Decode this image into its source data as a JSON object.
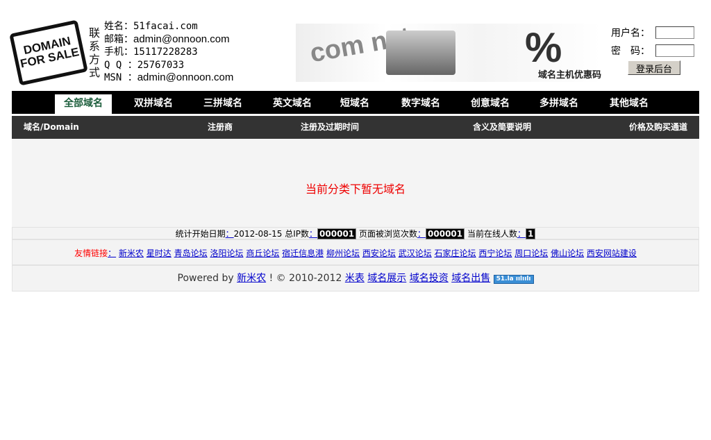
{
  "logo_text": "DOMAIN FOR SALE",
  "contact": {
    "heading": "联系方式",
    "rows": [
      {
        "label": "姓名：",
        "value": "51facai.com"
      },
      {
        "label": "邮箱：",
        "value": "admin@onnoon.com"
      },
      {
        "label": "手机：",
        "value": "15117228283"
      },
      {
        "label": "Q Q ：",
        "value": "25767033"
      },
      {
        "label": "MSN ：",
        "value": "admin@onnoon.com"
      }
    ]
  },
  "banner": {
    "caption": "域名主机优惠码",
    "art": "com net",
    "pct": "%"
  },
  "login": {
    "username_label": "用户名：",
    "password_label": "密　码：",
    "submit": "登录后台"
  },
  "nav": [
    "全部域名",
    "双拼域名",
    "三拼域名",
    "英文域名",
    "短域名",
    "数字域名",
    "创意域名",
    "多拼域名",
    "其他域名"
  ],
  "columns": [
    "域名/Domain",
    "注册商",
    "注册及过期时间",
    "含义及简要说明",
    "价格及购买通道"
  ],
  "empty_message": "当前分类下暂无域名",
  "stats": {
    "start_label": "统计开始日期",
    "start": "2012-08-15",
    "ip_label": "总IP数",
    "ip": "000001",
    "views_label": "页面被浏览次数",
    "views": "000001",
    "online_label": "当前在线人数",
    "online": "1",
    "sep": "："
  },
  "links": {
    "label": "友情链接",
    "sep": "：",
    "items": [
      "新米农",
      "星时达",
      "青岛论坛",
      "洛阳论坛",
      "商丘论坛",
      "宿迁信息港",
      "柳州论坛",
      "西安论坛",
      "武汉论坛",
      "石家庄论坛",
      "西宁论坛",
      "周口论坛",
      "佛山论坛",
      "西安网站建设"
    ]
  },
  "footer": {
    "powered": "Powered by",
    "brand": "新米农",
    "copy": "! © 2010-2012",
    "links": [
      "米表",
      "域名展示",
      "域名投资",
      "域名出售"
    ],
    "badge": "51.la ıılıılı"
  }
}
